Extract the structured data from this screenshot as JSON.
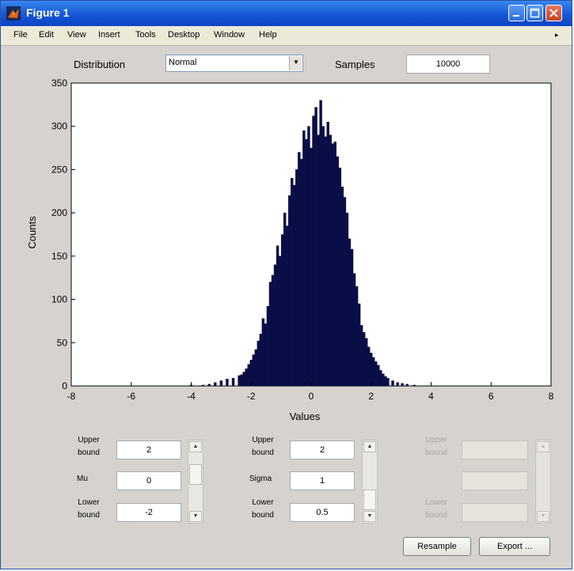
{
  "window": {
    "title": "Figure 1"
  },
  "menu": [
    "File",
    "Edit",
    "View",
    "Insert",
    "Tools",
    "Desktop",
    "Window",
    "Help"
  ],
  "controls": {
    "distribution_label": "Distribution",
    "distribution_value": "Normal",
    "samples_label": "Samples",
    "samples_value": "10000"
  },
  "params": {
    "left": {
      "upper_label_1": "Upper",
      "upper_label_2": "bound",
      "upper_value": "2",
      "mid_label": "Mu",
      "mid_value": "0",
      "lower_label_1": "Lower",
      "lower_label_2": "bound",
      "lower_value": "-2"
    },
    "middle": {
      "upper_label_1": "Upper",
      "upper_label_2": "bound",
      "upper_value": "2",
      "mid_label": "Sigma",
      "mid_value": "1",
      "lower_label_1": "Lower",
      "lower_label_2": "bound",
      "lower_value": "0.5"
    },
    "right": {
      "upper_label_1": "Upper",
      "upper_label_2": "bound",
      "lower_label_1": "Lower",
      "lower_label_2": "bound"
    }
  },
  "buttons": {
    "resample": "Resample",
    "export": "Export ..."
  },
  "colors": {
    "bar": "#0a0f4a",
    "titlebar": "#1556d6",
    "panel": "#d6d3ce"
  },
  "chart_data": {
    "type": "bar",
    "title": "",
    "xlabel": "Values",
    "ylabel": "Counts",
    "xlim": [
      -8,
      8
    ],
    "ylim": [
      0,
      350
    ],
    "xticks": [
      -8,
      -6,
      -4,
      -2,
      0,
      2,
      4,
      6,
      8
    ],
    "yticks": [
      0,
      50,
      100,
      150,
      200,
      250,
      300,
      350
    ],
    "grid": false,
    "bin_width": 0.08,
    "bins": [
      [
        -4.0,
        1
      ],
      [
        -3.6,
        1
      ],
      [
        -3.4,
        2
      ],
      [
        -3.2,
        4
      ],
      [
        -3.0,
        6
      ],
      [
        -2.8,
        8
      ],
      [
        -2.6,
        9
      ],
      [
        -2.4,
        12
      ],
      [
        -2.32,
        13
      ],
      [
        -2.24,
        16
      ],
      [
        -2.16,
        20
      ],
      [
        -2.08,
        25
      ],
      [
        -2.0,
        30
      ],
      [
        -1.92,
        36
      ],
      [
        -1.84,
        42
      ],
      [
        -1.76,
        52
      ],
      [
        -1.68,
        60
      ],
      [
        -1.6,
        78
      ],
      [
        -1.52,
        72
      ],
      [
        -1.44,
        92
      ],
      [
        -1.36,
        120
      ],
      [
        -1.28,
        128
      ],
      [
        -1.2,
        140
      ],
      [
        -1.12,
        162
      ],
      [
        -1.04,
        150
      ],
      [
        -0.96,
        175
      ],
      [
        -0.88,
        200
      ],
      [
        -0.8,
        185
      ],
      [
        -0.72,
        220
      ],
      [
        -0.64,
        240
      ],
      [
        -0.56,
        232
      ],
      [
        -0.48,
        250
      ],
      [
        -0.4,
        270
      ],
      [
        -0.32,
        262
      ],
      [
        -0.24,
        295
      ],
      [
        -0.16,
        285
      ],
      [
        -0.08,
        300
      ],
      [
        0.0,
        275
      ],
      [
        0.08,
        312
      ],
      [
        0.16,
        322
      ],
      [
        0.24,
        290
      ],
      [
        0.32,
        330
      ],
      [
        0.4,
        300
      ],
      [
        0.48,
        288
      ],
      [
        0.56,
        305
      ],
      [
        0.64,
        290
      ],
      [
        0.72,
        280
      ],
      [
        0.8,
        282
      ],
      [
        0.88,
        265
      ],
      [
        0.96,
        252
      ],
      [
        1.04,
        230
      ],
      [
        1.12,
        218
      ],
      [
        1.2,
        200
      ],
      [
        1.28,
        170
      ],
      [
        1.36,
        158
      ],
      [
        1.44,
        130
      ],
      [
        1.52,
        115
      ],
      [
        1.6,
        95
      ],
      [
        1.68,
        70
      ],
      [
        1.76,
        62
      ],
      [
        1.84,
        55
      ],
      [
        1.92,
        45
      ],
      [
        2.0,
        38
      ],
      [
        2.08,
        33
      ],
      [
        2.16,
        28
      ],
      [
        2.24,
        24
      ],
      [
        2.32,
        18
      ],
      [
        2.4,
        14
      ],
      [
        2.48,
        11
      ],
      [
        2.56,
        9
      ],
      [
        2.72,
        6
      ],
      [
        2.88,
        4
      ],
      [
        3.04,
        3
      ],
      [
        3.2,
        2
      ],
      [
        3.44,
        1
      ]
    ]
  }
}
